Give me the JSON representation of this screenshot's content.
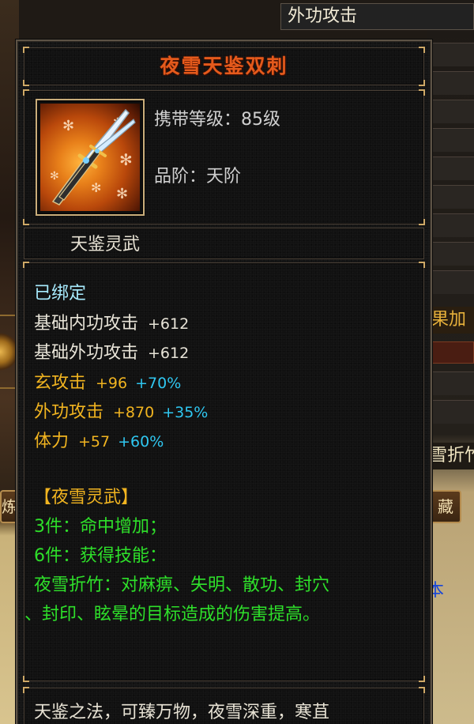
{
  "background": {
    "top_header": "外功攻击",
    "right_text_1": "果加",
    "right_text_2": "雪折竹",
    "left_button": "炼",
    "right_button": "藏",
    "right_text_3": "本"
  },
  "tooltip": {
    "title": "夜雪天鉴双刺",
    "level_line": "携带等级：85级",
    "grade_line": "品阶：天阶",
    "item_type": "天鉴灵武",
    "bound": "已绑定",
    "base_stats": [
      {
        "label": "基础内功攻击",
        "value": "+612"
      },
      {
        "label": "基础外功攻击",
        "value": "+612"
      }
    ],
    "bonus_stats": [
      {
        "label": "玄攻击",
        "value": "+96",
        "percent": "+70%"
      },
      {
        "label": "外功攻击",
        "value": "+870",
        "percent": "+35%"
      },
      {
        "label": "体力",
        "value": "+57",
        "percent": "+60%"
      }
    ],
    "set_name": "【夜雪灵武】",
    "set_bonus_3": "3件：命中增加；",
    "set_bonus_6": "6件：获得技能：",
    "set_skill_line1": "夜雪折竹：对麻痹、失明、散功、封穴",
    "set_skill_line2": "、封印、眩晕的目标造成的伤害提高。",
    "description": "天鉴之法，可臻万物，夜雪深重，寒苴"
  },
  "colors": {
    "title": "#e45a1c",
    "stat_white": "#e8e4d8",
    "stat_gold": "#f1b420",
    "stat_blue": "#2fc7f1",
    "set_green": "#2ee02a",
    "frame": "#c9ad7a"
  }
}
